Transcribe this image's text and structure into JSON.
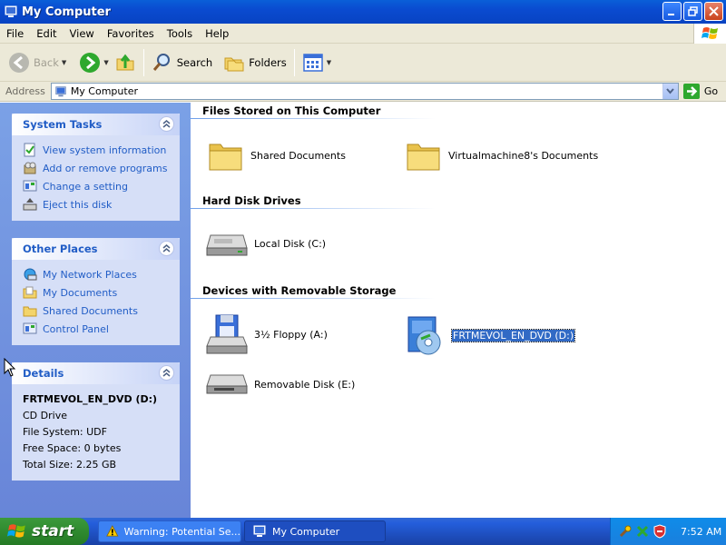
{
  "window": {
    "title": "My Computer"
  },
  "menu": [
    "File",
    "Edit",
    "View",
    "Favorites",
    "Tools",
    "Help"
  ],
  "toolbar": {
    "back": "Back",
    "search": "Search",
    "folders": "Folders"
  },
  "address": {
    "label": "Address",
    "value": "My Computer",
    "go": "Go"
  },
  "system_tasks": {
    "title": "System Tasks",
    "items": [
      "View system information",
      "Add or remove programs",
      "Change a setting",
      "Eject this disk"
    ]
  },
  "other_places": {
    "title": "Other Places",
    "items": [
      "My Network Places",
      "My Documents",
      "Shared Documents",
      "Control Panel"
    ]
  },
  "details": {
    "title": "Details",
    "name": "FRTMEVOL_EN_DVD (D:)",
    "type": "CD Drive",
    "file_system": "File System: UDF",
    "free_space": "Free Space: 0 bytes",
    "total_size": "Total Size: 2.25 GB"
  },
  "groups": {
    "files_stored": {
      "title": "Files Stored on This Computer",
      "items": [
        "Shared Documents",
        "Virtualmachine8's Documents"
      ]
    },
    "hard_disks": {
      "title": "Hard Disk Drives",
      "items": [
        "Local Disk (C:)"
      ]
    },
    "removable": {
      "title": "Devices with Removable Storage",
      "items": [
        "3½ Floppy (A:)",
        "FRTMEVOL_EN_DVD (D:)",
        "Removable Disk (E:)"
      ]
    }
  },
  "taskbar": {
    "start": "start",
    "tasks": [
      "Warning: Potential Se...",
      "My Computer"
    ],
    "clock": "7:52 AM"
  },
  "colors": {
    "accent": "#215dc6",
    "selection": "#316ac5",
    "taskbar": "#245edb",
    "start": "#2f8a2f"
  }
}
